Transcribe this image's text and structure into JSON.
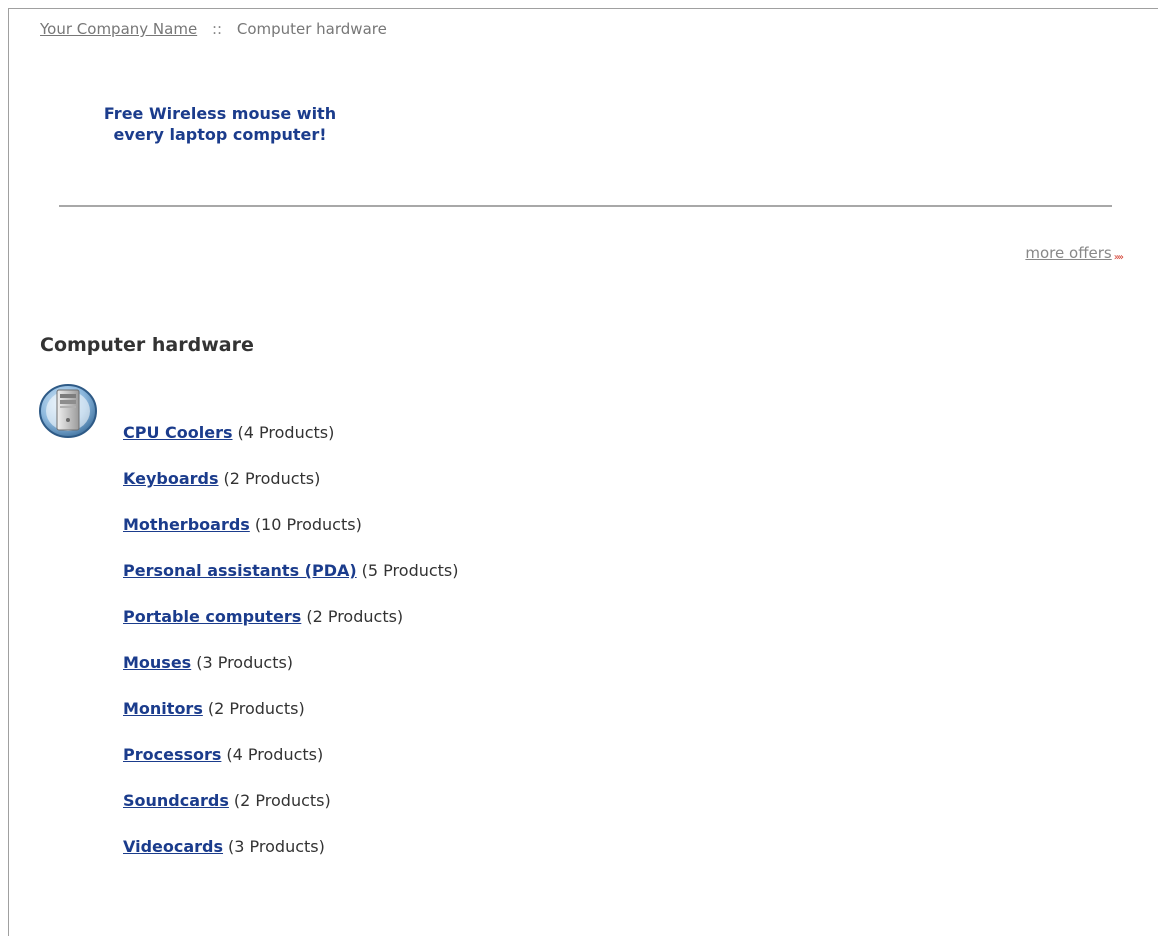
{
  "breadcrumb": {
    "home": "Your Company Name",
    "separator": "::",
    "current": "Computer hardware"
  },
  "promo": {
    "line1": "Free Wireless mouse with",
    "line2": "every laptop computer!"
  },
  "more_offers": {
    "label": "more offers",
    "arrow": "»»"
  },
  "section": {
    "title": "Computer hardware",
    "icon": "computer-tower-icon"
  },
  "categories": [
    {
      "name": "CPU Coolers",
      "count": "(4 Products)"
    },
    {
      "name": "Keyboards",
      "count": "(2 Products)"
    },
    {
      "name": "Motherboards",
      "count": "(10 Products)"
    },
    {
      "name": "Personal assistants (PDA)",
      "count": "(5 Products)"
    },
    {
      "name": "Portable computers",
      "count": "(2 Products)"
    },
    {
      "name": "Mouses",
      "count": "(3 Products)"
    },
    {
      "name": "Monitors",
      "count": "(2 Products)"
    },
    {
      "name": "Processors",
      "count": "(4 Products)"
    },
    {
      "name": "Soundcards",
      "count": "(2 Products)"
    },
    {
      "name": "Videocards",
      "count": "(3 Products)"
    }
  ],
  "colors": {
    "link": "#1b3c8c",
    "muted": "#777777",
    "accent": "#d33a2c"
  }
}
